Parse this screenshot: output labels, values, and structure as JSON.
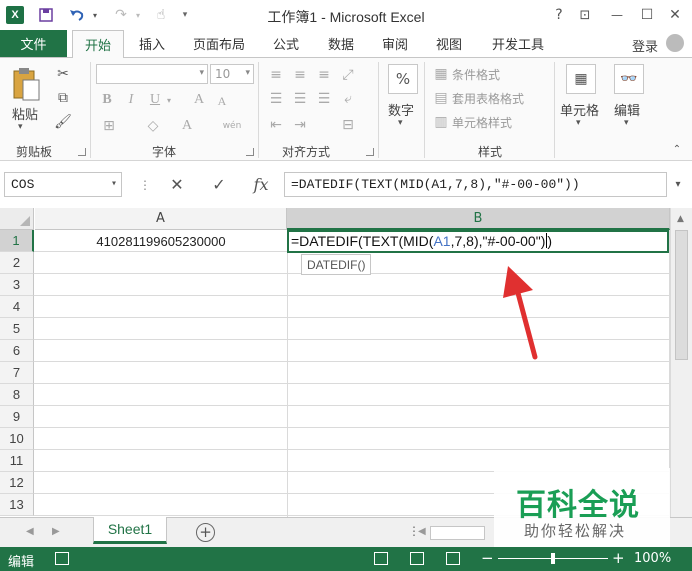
{
  "window": {
    "app_icon": "X",
    "title": "工作簿1 - Microsoft Excel",
    "help": "?",
    "restore_ribbon": "⊡",
    "minimize": "—",
    "maximize": "☐",
    "close": "✕"
  },
  "ribbon_tabs": {
    "file": "文件",
    "items": [
      "开始",
      "插入",
      "页面布局",
      "公式",
      "数据",
      "审阅",
      "视图",
      "开发工具"
    ],
    "active": "开始",
    "login": "登录"
  },
  "ribbon": {
    "clipboard": {
      "paste": "粘贴",
      "group": "剪贴板"
    },
    "font": {
      "size": "10",
      "bold": "B",
      "italic": "I",
      "underline": "U",
      "grow": "A",
      "shrink": "A",
      "color": "A",
      "phonetic": "wén",
      "group": "字体"
    },
    "alignment": {
      "group": "对齐方式"
    },
    "number": {
      "label": "数字",
      "percent": "%"
    },
    "styles": {
      "conditional": "条件格式",
      "table": "套用表格格式",
      "cell": "单元格样式",
      "group": "样式"
    },
    "cells": {
      "label": "单元格"
    },
    "editing": {
      "label": "编辑"
    }
  },
  "formula_bar": {
    "name_box": "COS",
    "cancel": "✕",
    "enter": "✓",
    "fx": "fx",
    "formula": "=DATEDIF(TEXT(MID(A1,7,8),\"#-00-00\"))"
  },
  "grid": {
    "columns": [
      "A",
      "B"
    ],
    "rows": [
      "1",
      "2",
      "3",
      "4",
      "5",
      "6",
      "7",
      "8",
      "9",
      "10",
      "11",
      "12",
      "13"
    ],
    "cell_A1": "410281199605230000",
    "cell_B1_parts": [
      "=DATEDIF(TEXT(MID(",
      "A1",
      ",7,8),\"#-00-00\")"
    ],
    "tooltip": "DATEDIF()"
  },
  "sheets": {
    "tabs": [
      "Sheet1"
    ],
    "add": "+"
  },
  "status": {
    "mode": "编辑",
    "zoom": "100%",
    "zoom_minus": "−",
    "zoom_plus": "+"
  },
  "watermark": {
    "brand": "百科全说",
    "slogan": "助你轻松解决"
  },
  "colors": {
    "excel_green": "#217346",
    "arrow_red": "#e03030",
    "watermark_green": "#1a9e55"
  }
}
